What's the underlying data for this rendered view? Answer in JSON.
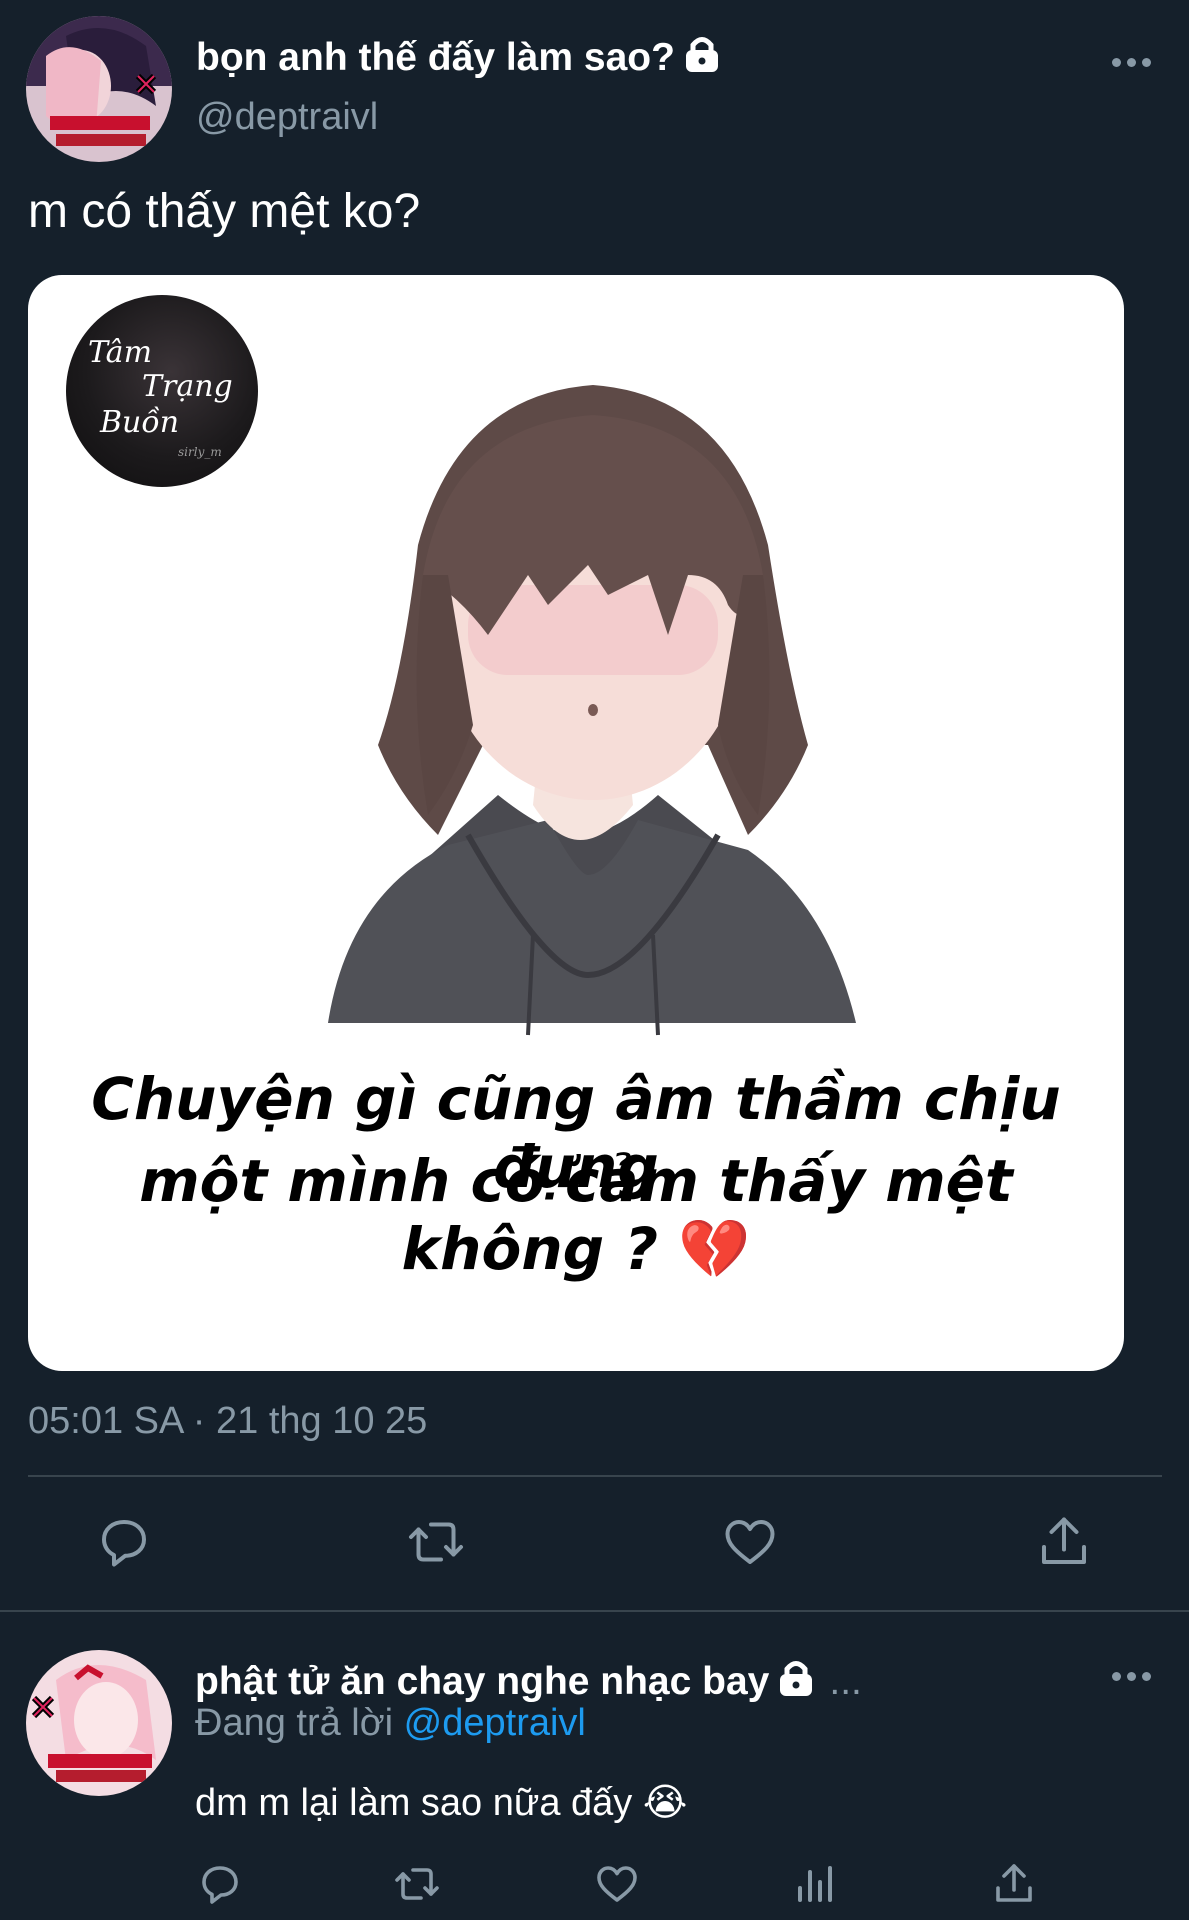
{
  "main_tweet": {
    "display_name": "bọn anh thế đấy làm sao?",
    "handle": "@deptraivl",
    "text": "m có thấy mệt ko?",
    "media": {
      "badge_lines": [
        "Tâm",
        "Trạng",
        "Buồn"
      ],
      "badge_small": "sirly_m",
      "caption_line1": "Chuyện gì cũng âm thầm chịu đựng",
      "caption_line2": "một mình có cảm thấy mệt không ?",
      "caption_emoji": "💔"
    },
    "timestamp": "05:01 SA · 21 thg 10 25",
    "actions": [
      "reply-icon",
      "retweet-icon",
      "like-icon",
      "share-icon"
    ]
  },
  "reply_tweet": {
    "display_name": "phật tử ăn chay nghe nhạc bay",
    "name_ellipsis": "...",
    "replying_prefix": "Đang trả lời",
    "replying_to": "@deptraivl",
    "text": "dm m lại làm sao nữa đấy",
    "text_emoji": "😭",
    "actions": [
      "reply-icon",
      "retweet-icon",
      "like-icon",
      "analytics-icon",
      "share-icon"
    ]
  },
  "colors": {
    "background": "#15202b",
    "secondary_text": "#8899a6",
    "link": "#1d9bf0",
    "divider": "#38444d"
  }
}
